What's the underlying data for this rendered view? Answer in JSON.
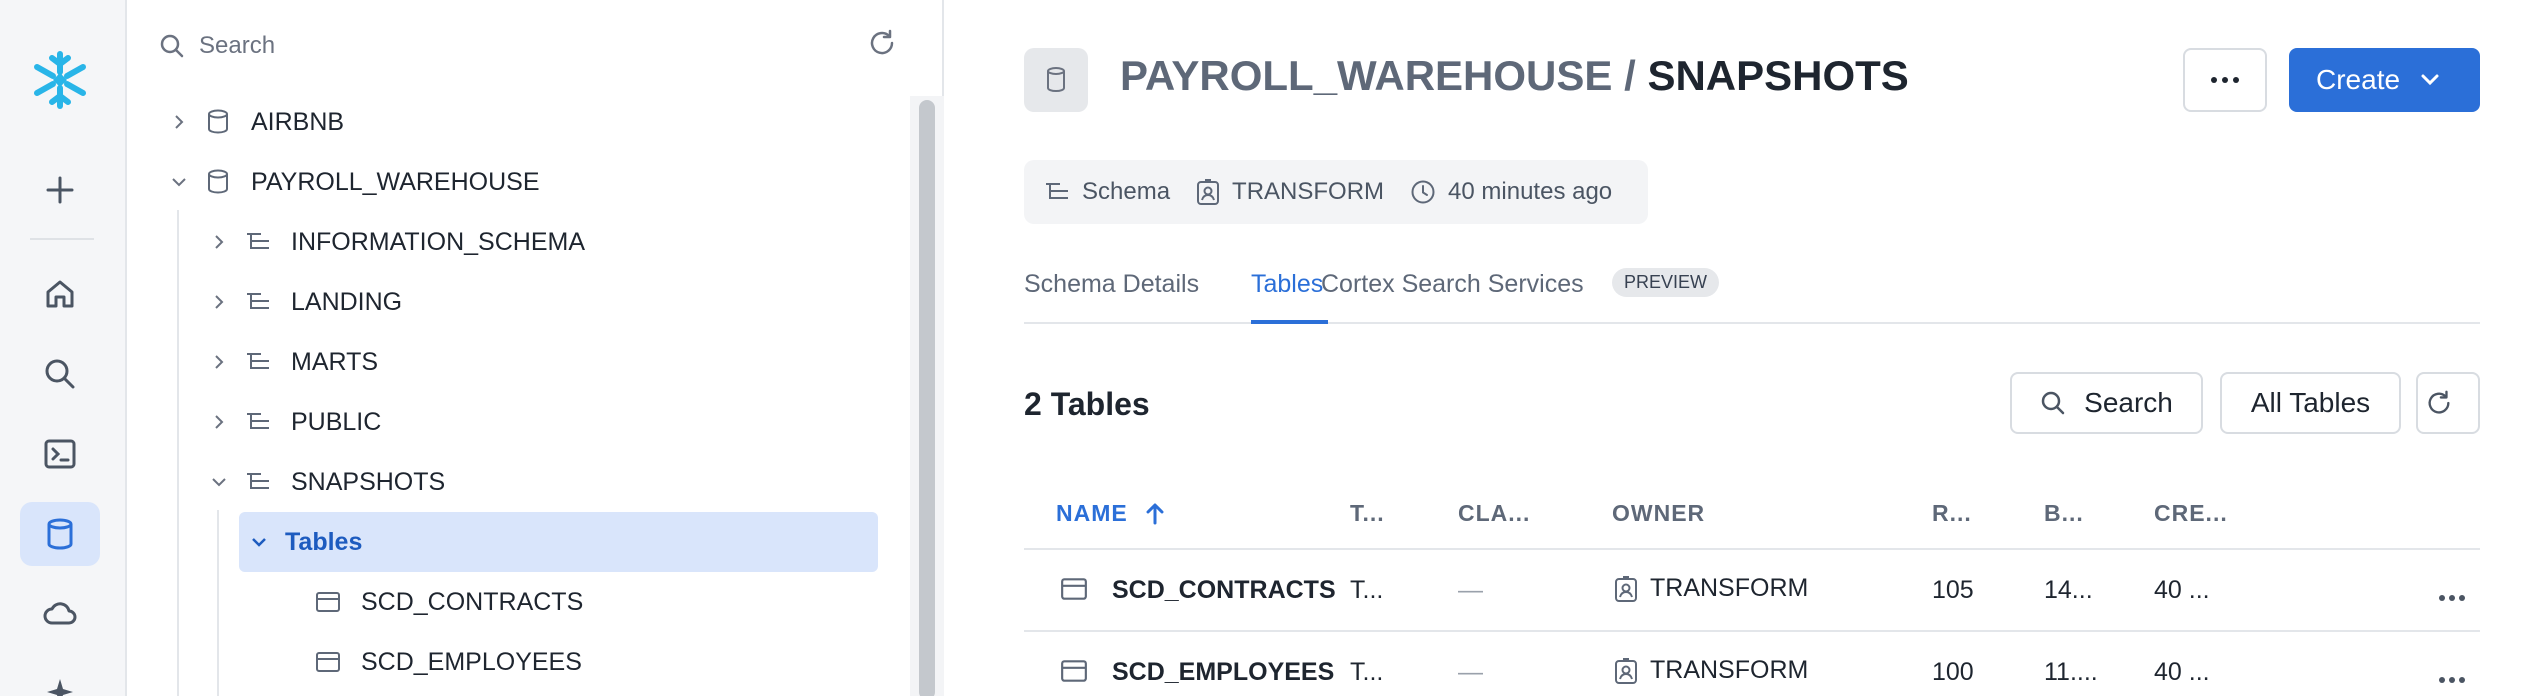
{
  "rail": {
    "items": [
      {
        "name": "snowflake-logo",
        "icon": "snowflake-icon"
      },
      {
        "name": "add",
        "icon": "plus-icon"
      },
      {
        "name": "home",
        "icon": "home-icon"
      },
      {
        "name": "search",
        "icon": "search-icon"
      },
      {
        "name": "projects",
        "icon": "terminal-icon"
      },
      {
        "name": "data",
        "icon": "database-icon",
        "active": true
      },
      {
        "name": "monitoring",
        "icon": "cloud-icon"
      }
    ],
    "accent": "#29b5e8"
  },
  "explorer": {
    "search_placeholder": "Search",
    "tree": [
      {
        "label": "AIRBNB",
        "type": "database",
        "expanded": false
      },
      {
        "label": "PAYROLL_WAREHOUSE",
        "type": "database",
        "expanded": true
      },
      {
        "label": "INFORMATION_SCHEMA",
        "type": "schema",
        "expanded": false
      },
      {
        "label": "LANDING",
        "type": "schema",
        "expanded": false
      },
      {
        "label": "MARTS",
        "type": "schema",
        "expanded": false
      },
      {
        "label": "PUBLIC",
        "type": "schema",
        "expanded": false
      },
      {
        "label": "SNAPSHOTS",
        "type": "schema",
        "expanded": true
      },
      {
        "label": "Tables",
        "type": "folder",
        "expanded": true,
        "selected": true
      },
      {
        "label": "SCD_CONTRACTS",
        "type": "table"
      },
      {
        "label": "SCD_EMPLOYEES",
        "type": "table"
      }
    ]
  },
  "header": {
    "database": "PAYROLL_WAREHOUSE",
    "separator": " / ",
    "schema": "SNAPSHOTS",
    "create_label": "Create"
  },
  "meta": {
    "type": "Schema",
    "owner": "TRANSFORM",
    "updated": "40 minutes ago"
  },
  "tabs": [
    {
      "label": "Schema Details"
    },
    {
      "label": "Tables",
      "active": true
    },
    {
      "label": "Cortex Search Services",
      "badge": "PREVIEW"
    }
  ],
  "tables_section": {
    "title": "2 Tables",
    "search_label": "Search",
    "filter_label": "All Tables",
    "columns": [
      "NAME",
      "T...",
      "CLA...",
      "OWNER",
      "R...",
      "B...",
      "CRE..."
    ],
    "rows": [
      {
        "name": "SCD_CONTRACTS",
        "type": "T...",
        "cluster": "—",
        "owner": "TRANSFORM",
        "rows": "105",
        "bytes": "14...",
        "created": "40 ..."
      },
      {
        "name": "SCD_EMPLOYEES",
        "type": "T...",
        "cluster": "—",
        "owner": "TRANSFORM",
        "rows": "100",
        "bytes": "11....",
        "created": "40 ..."
      }
    ]
  },
  "colors": {
    "primary": "#2b6fd8",
    "selected_bg": "#d9e5fb",
    "muted_text": "#5e6878"
  }
}
